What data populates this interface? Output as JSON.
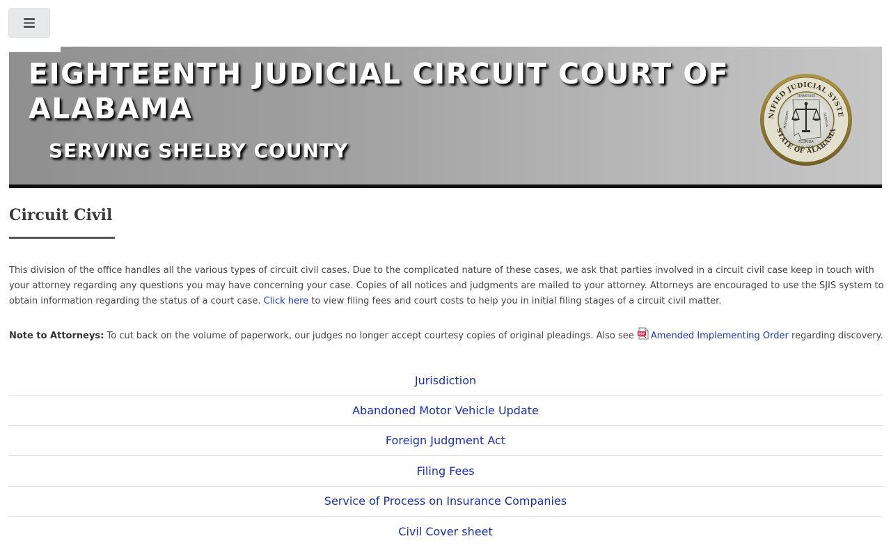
{
  "nav": {
    "menu_icon": "hamburger-menu-icon"
  },
  "header": {
    "title": "EIGHTEENTH JUDICIAL CIRCUIT COURT OF ALABAMA",
    "subtitle": "SERVING SHELBY COUNTY",
    "seal": {
      "top_text": "UNIFIED JUDICIAL SYSTEM",
      "bottom_text": "STATE OF ALABAMA",
      "inner_left": "MISSISSIPPI",
      "inner_top": "TENNESSEE",
      "inner_right": "GEORGIA",
      "inner_bottom": "FLORIDA",
      "year": "A.D. 1971"
    }
  },
  "main": {
    "title": "Circuit Civil",
    "intro_text": "This division of the office handles all the various types of circuit civil cases. Due to the complicated nature of these cases, we ask that parties involved in a circuit civil case keep in touch with your attorney regarding any questions you may have concerning your case. Copies of all notices and judgments are mailed to your attorney. Attorneys are encouraged to use the SJIS system to obtain information regarding the status of a court case.",
    "click_here_link": "Click here",
    "intro_after_link": "to view filing fees and court costs to help you in initial filing stages of a circuit civil matter.",
    "note_label": "Note to Attorneys:",
    "note_text": "To cut back on the volume of paperwork, our judges no longer accept courtesy copies of original pleadings. Also see",
    "note_icon": "pdf-file-icon",
    "note_link": "Amended Implementing Order",
    "note_after_link": "regarding discovery.",
    "links": [
      "Jurisdiction",
      "Abandoned Motor Vehicle Update",
      "Foreign Judgment Act",
      "Filing Fees",
      "Service of Process on Insurance Companies",
      "Civil Cover sheet"
    ]
  },
  "colors": {
    "link": "#1a2fb0",
    "banner_gradient_start": "#8f8f8f",
    "banner_gradient_end": "#c6c6c6",
    "banner_border": "#111111"
  }
}
